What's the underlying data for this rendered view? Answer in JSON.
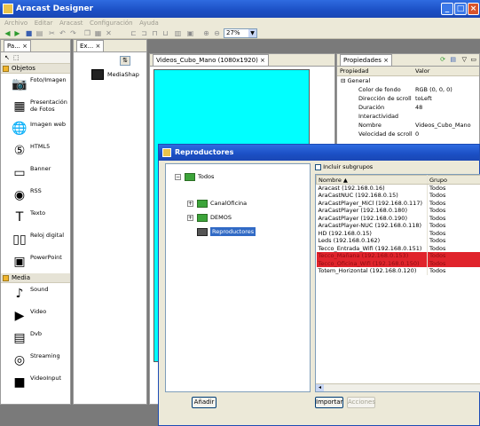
{
  "window": {
    "title": "Aracast Designer"
  },
  "menu": [
    "Archivo",
    "Editar",
    "Aracast",
    "Configuración",
    "Ayuda"
  ],
  "toolbar": {
    "zoom": "27%"
  },
  "palette": {
    "tab_label": "Pa...",
    "groups": [
      {
        "label": "Objetos",
        "items": [
          {
            "label": "Foto/Imagen",
            "icon": "camera-icon"
          },
          {
            "label": "Presentación de Fotos",
            "icon": "slideshow-icon"
          },
          {
            "label": "Imagen web",
            "icon": "globe-icon"
          },
          {
            "label": "HTML5",
            "icon": "html5-icon"
          },
          {
            "label": "Banner",
            "icon": "banner-icon"
          },
          {
            "label": "RSS",
            "icon": "rss-icon"
          },
          {
            "label": "Texto",
            "icon": "text-icon"
          },
          {
            "label": "Reloj digital",
            "icon": "clock-icon"
          },
          {
            "label": "PowerPoint",
            "icon": "powerpoint-icon"
          }
        ]
      },
      {
        "label": "Media",
        "items": [
          {
            "label": "Sound",
            "icon": "music-icon"
          },
          {
            "label": "Video",
            "icon": "video-icon"
          },
          {
            "label": "Dvb",
            "icon": "dvb-icon"
          },
          {
            "label": "Streaming",
            "icon": "streaming-icon"
          },
          {
            "label": "VideoInput",
            "icon": "video-input-icon"
          }
        ]
      }
    ]
  },
  "explorer": {
    "tab_label": "Ex...",
    "item": "MediaShap"
  },
  "editor": {
    "tab_label": "Videos_Cubo_Mano (1080x1920)"
  },
  "properties": {
    "tab_label": "Propiedades",
    "columns": [
      "Propiedad",
      "Valor"
    ],
    "category": "General",
    "rows": [
      {
        "name": "Color de fondo",
        "value": "RGB (0, 0, 0)"
      },
      {
        "name": "Dirección de scroll",
        "value": "toLeft"
      },
      {
        "name": "Duración",
        "value": "48"
      },
      {
        "name": "Interactividad",
        "value": ""
      },
      {
        "name": "Nombre",
        "value": "Videos_Cubo_Mano"
      },
      {
        "name": "Velocidad de scroll",
        "value": "0"
      }
    ]
  },
  "dialog": {
    "title": "Reproductores",
    "tree": [
      {
        "label": "Todos",
        "level": 0,
        "expander": "−"
      },
      {
        "label": "CanalOficina",
        "level": 1,
        "expander": "+"
      },
      {
        "label": "DEMOS",
        "level": 1,
        "expander": "+"
      },
      {
        "label": "Reproductores",
        "level": 1,
        "expander": "",
        "selected": true
      }
    ],
    "include_subgroups_label": "Incluir subgrupos",
    "columns": [
      "Nombre",
      "Grupo"
    ],
    "rows": [
      {
        "name": "Aracast (192.168.0.16)",
        "group": "Todos",
        "sel": false
      },
      {
        "name": "AraCastNUC (192.168.0.15)",
        "group": "Todos",
        "sel": false
      },
      {
        "name": "AraCastPlayer_MiCl (192.168.0.117)",
        "group": "Todos",
        "sel": false
      },
      {
        "name": "AraCastPlayer (192.168.0.180)",
        "group": "Todos",
        "sel": false
      },
      {
        "name": "AraCastPlayer (192.168.0.190)",
        "group": "Todos",
        "sel": false
      },
      {
        "name": "AraCastPlayer-NUC (192.168.0.118)",
        "group": "Todos",
        "sel": false
      },
      {
        "name": "HD (192.168.0.15)",
        "group": "Todos",
        "sel": false
      },
      {
        "name": "Leds (192.168.0.162)",
        "group": "Todos",
        "sel": false
      },
      {
        "name": "Tecco_Entrada_Wifi (192.168.0.151)",
        "group": "Todos",
        "sel": false
      },
      {
        "name": "Tecco_Mañana (192.168.0.153)",
        "group": "Todos",
        "sel": true
      },
      {
        "name": "Tecco_Oficina_Wifi (192.168.0.150)",
        "group": "Todos",
        "sel": true
      },
      {
        "name": "Totem_Horizontal (192.168.0.120)",
        "group": "Todos",
        "sel": false
      }
    ],
    "buttons": {
      "add": "Añadir",
      "import": "Importar",
      "actions": "Acciones"
    }
  }
}
